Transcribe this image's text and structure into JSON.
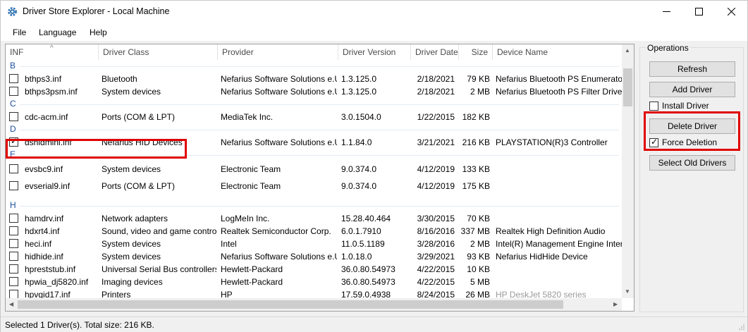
{
  "window": {
    "title": "Driver Store Explorer - Local Machine",
    "app_icon": "gear-icon"
  },
  "menu": {
    "items": [
      "File",
      "Language",
      "Help"
    ]
  },
  "list": {
    "columns": [
      "INF",
      "Driver Class",
      "Provider",
      "Driver Version",
      "Driver Date",
      "Size",
      "Device Name"
    ],
    "groups": [
      {
        "letter": "B",
        "rows": [
          {
            "inf": "bthps3.inf",
            "class": "Bluetooth",
            "provider": "Nefarius Software Solutions e.U.",
            "version": "1.3.125.0",
            "date": "2/18/2021",
            "size": "79 KB",
            "device": "Nefarius Bluetooth PS Enumerator",
            "checked": false
          },
          {
            "inf": "bthps3psm.inf",
            "class": "System devices",
            "provider": "Nefarius Software Solutions e.U.",
            "version": "1.3.125.0",
            "date": "2/18/2021",
            "size": "2 MB",
            "device": "Nefarius Bluetooth PS Filter Driver",
            "checked": false
          }
        ]
      },
      {
        "letter": "C",
        "rows": [
          {
            "inf": "cdc-acm.inf",
            "class": "Ports (COM & LPT)",
            "provider": "MediaTek Inc.",
            "version": "3.0.1504.0",
            "date": "1/22/2015",
            "size": "182 KB",
            "device": "",
            "checked": false
          }
        ]
      },
      {
        "letter": "D",
        "rows": [
          {
            "inf": "dshidmini.inf",
            "class": "Nefarius HID Devices",
            "provider": "Nefarius Software Solutions e.U.",
            "version": "1.1.84.0",
            "date": "3/21/2021",
            "size": "216 KB",
            "device": "PLAYSTATION(R)3 Controller",
            "checked": true
          }
        ]
      },
      {
        "letter": "E",
        "rows": [
          {
            "inf": "evsbc9.inf",
            "class": "System devices",
            "provider": "Electronic Team",
            "version": "9.0.374.0",
            "date": "4/12/2019",
            "size": "133 KB",
            "device": "",
            "checked": false
          },
          {
            "inf": "evserial9.inf",
            "class": "Ports (COM & LPT)",
            "provider": "Electronic Team",
            "version": "9.0.374.0",
            "date": "4/12/2019",
            "size": "175 KB",
            "device": "",
            "checked": false
          }
        ]
      },
      {
        "letter": "H",
        "rows": [
          {
            "inf": "hamdrv.inf",
            "class": "Network adapters",
            "provider": "LogMeIn Inc.",
            "version": "15.28.40.464",
            "date": "3/30/2015",
            "size": "70 KB",
            "device": "",
            "checked": false
          },
          {
            "inf": "hdxrt4.inf",
            "class": "Sound, video and game controll...",
            "provider": "Realtek Semiconductor Corp.",
            "version": "6.0.1.7910",
            "date": "8/16/2016",
            "size": "337 MB",
            "device": "Realtek High Definition Audio",
            "checked": false
          },
          {
            "inf": "heci.inf",
            "class": "System devices",
            "provider": "Intel",
            "version": "11.0.5.1189",
            "date": "3/28/2016",
            "size": "2 MB",
            "device": "Intel(R) Management Engine Interface",
            "checked": false
          },
          {
            "inf": "hidhide.inf",
            "class": "System devices",
            "provider": "Nefarius Software Solutions e.U.",
            "version": "1.0.18.0",
            "date": "3/29/2021",
            "size": "93 KB",
            "device": "Nefarius HidHide Device",
            "checked": false
          },
          {
            "inf": "hpreststub.inf",
            "class": "Universal Serial Bus controllers",
            "provider": "Hewlett-Packard",
            "version": "36.0.80.54973",
            "date": "4/22/2015",
            "size": "10 KB",
            "device": "",
            "checked": false
          },
          {
            "inf": "hpwia_dj5820.inf",
            "class": "Imaging devices",
            "provider": "Hewlett-Packard",
            "version": "36.0.80.54973",
            "date": "4/22/2015",
            "size": "5 MB",
            "device": "",
            "checked": false
          },
          {
            "inf": "hpvgid17.inf",
            "class": "Printers",
            "provider": "HP",
            "version": "17.59.0.4938",
            "date": "8/24/2015",
            "size": "26 MB",
            "device": "HP DeskJet 5820 series",
            "checked": false
          }
        ]
      }
    ]
  },
  "operations": {
    "label": "Operations",
    "refresh": "Refresh",
    "add_driver": "Add Driver",
    "install_driver": "Install Driver",
    "install_driver_checked": false,
    "delete_driver": "Delete Driver",
    "force_deletion": "Force Deletion",
    "force_deletion_checked": true,
    "select_old": "Select Old Drivers"
  },
  "status": {
    "text": "Selected 1 Driver(s). Total size: 216 KB."
  },
  "colors": {
    "highlight": "#e00000",
    "group_letter": "#1e4f9c"
  }
}
